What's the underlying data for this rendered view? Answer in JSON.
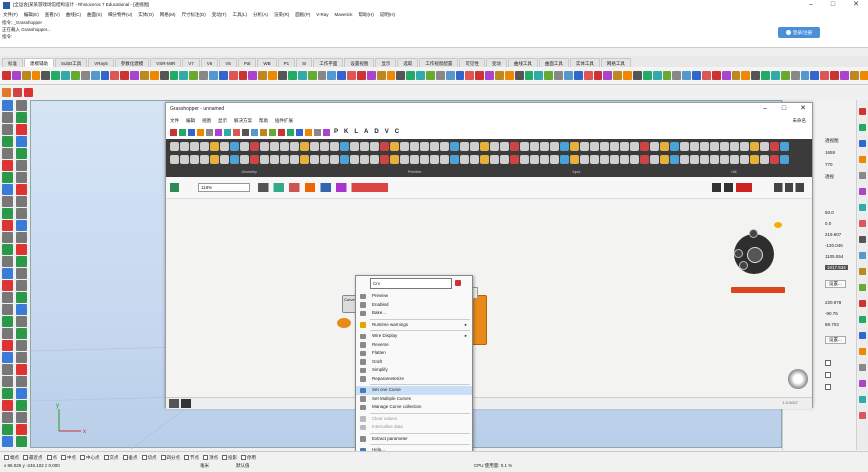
{
  "window": {
    "title": "[全运会]某某游戏场馆结构设计 - Rhinoceros 7 Educational - [透视图]"
  },
  "main_menu": [
    "文件(F)",
    "编辑(E)",
    "查看(V)",
    "曲线(C)",
    "曲面(S)",
    "细分物件(U)",
    "实体(O)",
    "网格(M)",
    "尺寸标注(D)",
    "变动(T)",
    "工具(L)",
    "分析(A)",
    "渲染(R)",
    "面板(P)",
    "V-Ray",
    "Maverick",
    "帮助(H)",
    "说明(H)"
  ],
  "command_history": [
    "指令: _Grasshopper",
    "正在载入 Grasshopper...",
    "指令:"
  ],
  "login_button": "登录/注册",
  "rhino_tabs": [
    "标准",
    "建模辅助",
    "SubD工具",
    "VRay5",
    "参数化建模",
    "VSR-MIR",
    "V7",
    "V6",
    "V5",
    "Pal",
    "WB",
    "P1",
    "SI",
    "工作平面",
    "设置视图",
    "显示",
    "选取",
    "工作视窗配置",
    "可见性",
    "变动",
    "曲线工具",
    "曲面工具",
    "实体工具",
    "网格工具"
  ],
  "right_panel": {
    "values": [
      "透视图",
      "1659",
      "770",
      "透视",
      "50.0",
      "0.0",
      "219.607",
      "-120.046",
      "1105.554",
      "1017.534",
      "设置...",
      "220.978",
      "-90.76",
      "88.703",
      "设置..."
    ]
  },
  "grasshopper": {
    "title": "Grasshopper - unnamed",
    "menu": [
      "文件",
      "编辑",
      "视图",
      "显示",
      "解决方案",
      "帮助",
      "插件扩展"
    ],
    "menu_right": "未命名",
    "tab_letters": [
      "P",
      "K",
      "L",
      "A",
      "D",
      "V",
      "C"
    ],
    "zoom": "118%",
    "panel_labels": [
      "Geometry",
      "Primitive",
      "Input",
      "Util"
    ],
    "version": "1.0.0007"
  },
  "context_menu": {
    "search_value": "Crv",
    "items": [
      {
        "label": "Preview",
        "arrow": false,
        "highlight": false,
        "disabled": false
      },
      {
        "label": "Enabled",
        "arrow": false,
        "highlight": false,
        "disabled": false
      },
      {
        "label": "Bake...",
        "arrow": false,
        "highlight": false,
        "disabled": false
      },
      {
        "label": "Runtime warnings",
        "arrow": true,
        "highlight": false,
        "disabled": false
      },
      {
        "label": "Wire Display",
        "arrow": true,
        "highlight": false,
        "disabled": false
      },
      {
        "label": "Reverse",
        "arrow": false,
        "highlight": false,
        "disabled": false
      },
      {
        "label": "Flatten",
        "arrow": false,
        "highlight": false,
        "disabled": false
      },
      {
        "label": "Graft",
        "arrow": false,
        "highlight": false,
        "disabled": false
      },
      {
        "label": "Simplify",
        "arrow": false,
        "highlight": false,
        "disabled": false
      },
      {
        "label": "Reparameterize",
        "arrow": false,
        "highlight": false,
        "disabled": false
      },
      {
        "label": "Set one Curve",
        "arrow": false,
        "highlight": true,
        "disabled": false
      },
      {
        "label": "Set Multiple Curves",
        "arrow": false,
        "highlight": false,
        "disabled": false
      },
      {
        "label": "Manage Curve collection",
        "arrow": false,
        "highlight": false,
        "disabled": false
      },
      {
        "label": "Clear values",
        "arrow": false,
        "highlight": false,
        "disabled": true
      },
      {
        "label": "Internalise data",
        "arrow": false,
        "highlight": false,
        "disabled": true
      },
      {
        "label": "Extract parameter",
        "arrow": false,
        "highlight": false,
        "disabled": false
      },
      {
        "label": "Help...",
        "arrow": false,
        "highlight": false,
        "disabled": false
      }
    ]
  },
  "canvas_node": {
    "label": "Curve"
  },
  "osnaps": [
    "端点",
    "最近点",
    "点",
    "中点",
    "中心点",
    "交点",
    "垂点",
    "切点",
    "四分点",
    "节点",
    "顶点",
    "投影",
    "停用"
  ],
  "status": {
    "coords": "x 86.026   y -246.102   z 0.000",
    "units": "毫米",
    "layer": "默认值",
    "cpu": "CPU 使用量: 0.1 %"
  },
  "colors": {
    "accent": "#4a90d9",
    "gh_panel": "#3b3b3b",
    "viewport": "#c7d9f0",
    "gh_node": "#e88a1a"
  }
}
